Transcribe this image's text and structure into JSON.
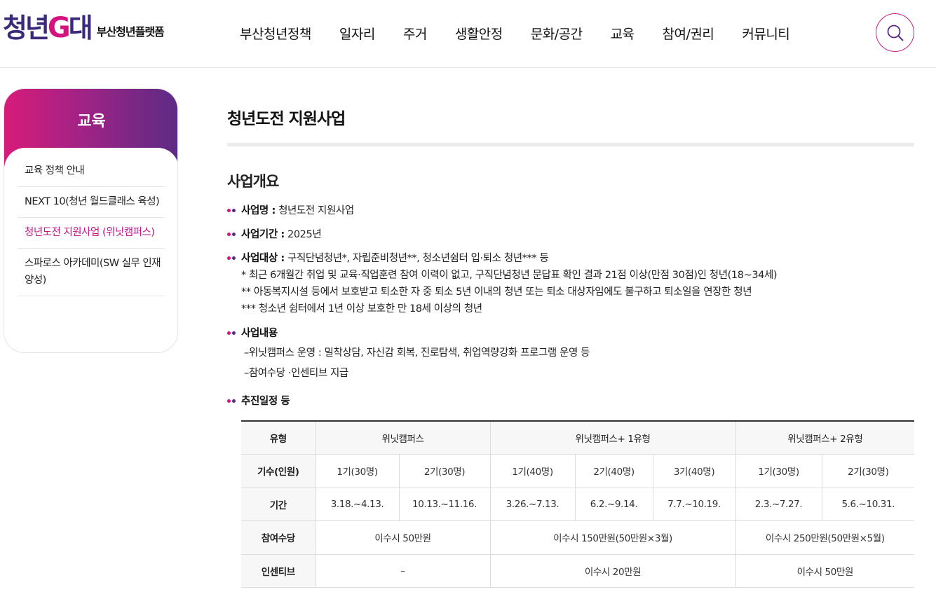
{
  "header": {
    "logo_main": "청년",
    "logo_g": "G",
    "logo_end": "대",
    "logo_sub": "부산청년플랫폼",
    "nav": [
      "부산청년정책",
      "일자리",
      "주거",
      "생활안정",
      "문화/공간",
      "교육",
      "참여/권리",
      "커뮤니티"
    ],
    "search_icon": "search-icon"
  },
  "sidebar": {
    "title": "교육",
    "items": [
      {
        "label": "교육 정책 안내"
      },
      {
        "label": "NEXT 10(청년 월드클래스 육성)"
      },
      {
        "label": "청년도전 지원사업 (위닛캠퍼스)"
      },
      {
        "label": "스파로스 아카데미(SW 실무 인재 양성)"
      }
    ],
    "active_index": 2
  },
  "main": {
    "page_title": "청년도전 지원사업",
    "section_title": "사업개요",
    "name_label": "사업명 :",
    "name_value": " 청년도전 지원사업",
    "period_label": "사업기간 :",
    "period_value": " 2025년",
    "target_label": "사업대상 :",
    "target_value": " 구직단념청년*, 자립준비청년**, 청소년쉼터 입·퇴소 청년*** 등",
    "target_notes": [
      "* 최근 6개월간 취업 및 교육·직업훈련 참여 이력이 없고, 구직단념청년 문답표 확인 결과 21점 이상(만점 30점)인 청년(18~34세)",
      "** 아동복지시설 등에서 보호받고 퇴소한 자 중 퇴소 5년 이내의 청년 또는 퇴소 대상자임에도 불구하고 퇴소일을 연장한 청년",
      "*** 청소년 쉼터에서 1년 이상 보호한 만 18세 이상의 청년"
    ],
    "content_label": "사업내용",
    "content_lines": [
      "–위닛캠퍼스 운영 : 밀착상담, 자신감 회복, 진로탐색, 취업역량강화 프로그램 운영 등",
      "–참여수당 ·인센티브 지급"
    ],
    "schedule_label": "추진일정 등"
  },
  "table": {
    "type_header": "유형",
    "groups": [
      "위닛캠퍼스",
      "위닛캠퍼스+ 1유형",
      "위닛캠퍼스+ 2유형"
    ],
    "row_cohort_label": "기수(인원)",
    "cohorts": [
      "1기(30명)",
      "2기(30명)",
      "1기(40명)",
      "2기(40명)",
      "3기(40명)",
      "1기(30명)",
      "2기(30명)"
    ],
    "row_period_label": "기간",
    "periods": [
      "3.18.~4.13.",
      "10.13.~11.16.",
      "3.26.~7.13.",
      "6.2.~9.14.",
      "7.7.~10.19.",
      "2.3.~7.27.",
      "5.6.~10.31."
    ],
    "row_allowance_label": "참여수당",
    "allowances": [
      "이수시 50만원",
      "이수시 150만원(50만원×3월)",
      "이수시 250만원(50만원×5월)"
    ],
    "row_incentive_label": "인센티브",
    "incentives": [
      "–",
      "이수시 20만원",
      "이수시 50만원"
    ]
  },
  "colors": {
    "accent": "#c3168a",
    "brand_purple": "#5b2a86",
    "brand_pink": "#d6127e"
  }
}
